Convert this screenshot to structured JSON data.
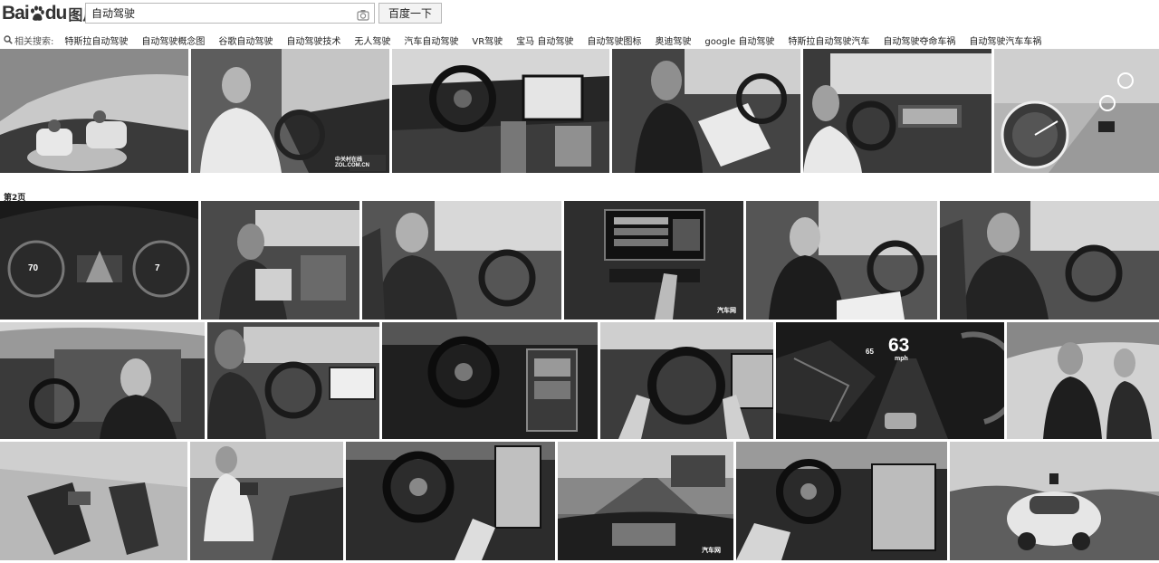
{
  "logo": {
    "part1": "Bai",
    "part2": "du",
    "part3": "图片"
  },
  "search": {
    "query": "自动驾驶",
    "button": "百度一下"
  },
  "related": {
    "label": "相关搜索:",
    "items": [
      "特斯拉自动驾驶",
      "自动驾驶概念图",
      "谷歌自动驾驶",
      "自动驾驶技术",
      "无人驾驶",
      "汽车自动驾驶",
      "VR驾驶",
      "宝马 自动驾驶",
      "自动驾驶图标",
      "奥迪驾驶",
      "google 自动驾驶",
      "特斯拉自动驾驶汽车",
      "自动驾驶夺命车祸",
      "自动驾驶汽车车祸"
    ]
  },
  "page2_label": "第2页",
  "overlays": {
    "speed_70": "70",
    "speed_7": "7",
    "speed_63": "63",
    "speed_65": "65",
    "mph": "mph",
    "zol_brand": "中关村在线",
    "zol_domain": "ZOL.COM.CN",
    "autohome": "汽车网"
  }
}
